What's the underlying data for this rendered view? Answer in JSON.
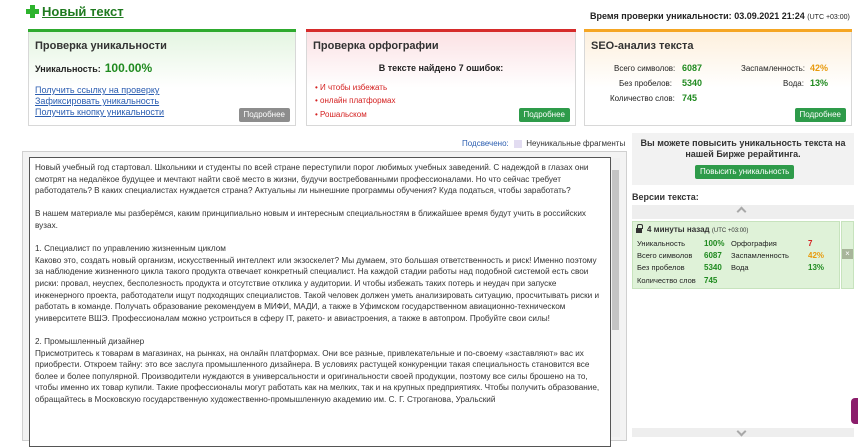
{
  "header": {
    "new_text": "Новый текст",
    "check_time_label": "Время проверки уникальности:",
    "check_time_value": "03.09.2021 21:24",
    "tz": "(UTC +03:00)"
  },
  "uniqueness": {
    "title": "Проверка уникальности",
    "label": "Уникальность:",
    "value": "100.00%",
    "links": [
      "Получить ссылку на проверку",
      "Зафиксировать уникальность",
      "Получить кнопку уникальности"
    ],
    "more": "Подробнее"
  },
  "spelling": {
    "title": "Проверка орфографии",
    "found": "В тексте найдено 7 ошибок:",
    "errors": [
      "И чтобы избежать",
      "онлайн платформах",
      "Рошальском"
    ],
    "more": "Подробнее"
  },
  "seo": {
    "title": "SEO-анализ текста",
    "chars_label": "Всего символов:",
    "chars": "6087",
    "nospace_label": "Без пробелов:",
    "nospace": "5340",
    "words_label": "Количество слов:",
    "words": "745",
    "nausea_label": "Заспамленность:",
    "nausea": "42%",
    "water_label": "Вода:",
    "water": "13%",
    "more": "Подробнее"
  },
  "highlight": {
    "label": "Подсвечено:",
    "legend": "Неуникальные фрагменты"
  },
  "text": {
    "p1": "Новый учебный год стартовал. Школьники и студенты по всей стране переступили порог любимых учебных заведений. С надеждой в глазах они смотрят на недалёкое будущее и мечтают найти своё место в жизни, будучи востребованными профессионалами. Но что сейчас требует работодатель? В каких специалистах нуждается страна? Актуальны ли нынешние программы обучения? Куда податься, чтобы заработать?",
    "p2": "В нашем материале мы разберёмся, каким принципиально новым и интересным специальностям в ближайшее время будут учить в российских вузах.",
    "h1": "1. Специалист по управлению жизненным циклом",
    "p3": "Каково это, создать новый организм, искусственный интеллект или экзоскелет? Мы думаем, это большая ответственность и риск! Именно поэтому за наблюдение жизненного цикла такого продукта отвечает конкретный специалист. На каждой стадии работы над подобной системой есть свои риски: провал, неуспех, бесполезность продукта и отсутствие отклика у аудитории. И чтобы избежать таких потерь и неудач при запуске инженерного проекта, работодатели ищут подходящих специалистов. Такой человек должен уметь анализировать ситуацию, просчитывать риски и работать в команде. Получать образование рекомендуем в МИФИ, МАДИ, а также в Уфимском государственном авиационно-техническом университете ВШЭ. Профессионалам можно устроиться в сферу IT, ракето- и авиастроения, а также в автопром. Пробуйте свои силы!",
    "h2": "2. Промышленный дизайнер",
    "p4": "Присмотритесь к товарам в магазинах, на рынках, на онлайн платформах. Они все разные, привлекательные и по-своему «заставляют» вас их приобрести. Откроем тайну: это все заслуга промышленного дизайнера. В условиях растущей конкуренции такая специальность становится все более и более популярной. Производители нуждаются в универсальности и оригинальности своей продукции, поэтому все силы брошено на то, чтобы именно их товар купили. Такие профессионалы могут работать как на мелких, так и на крупных предприятиях. Чтобы получить образование, обращайтесь в Московскую государственную художественно-промышленную академию им. С. Г. Строганова, Уральский"
  },
  "promo": {
    "text": "Вы можете повысить уникальность текста на нашей Бирже рерайтинга.",
    "button": "Повысить уникальность"
  },
  "versions": {
    "title": "Версии текста:",
    "time": "4 минуты назад",
    "tz": "(UTC +03:00)",
    "uniq_label": "Уникальность",
    "uniq": "100%",
    "chars_label": "Всего символов",
    "chars": "6087",
    "nospace_label": "Без пробелов",
    "nospace": "5340",
    "words_label": "Количество слов",
    "words": "745",
    "spell_label": "Орфография",
    "spell": "7",
    "nausea_label": "Заспамленность",
    "nausea": "42%",
    "water_label": "Вода",
    "water": "13%",
    "close": "×"
  },
  "colors": {
    "green_accent": "#2eaa2e",
    "red_accent": "#d62b2b",
    "orange_accent": "#f5a623",
    "button_green": "#2e9b4a",
    "link_blue": "#2a5db0"
  }
}
